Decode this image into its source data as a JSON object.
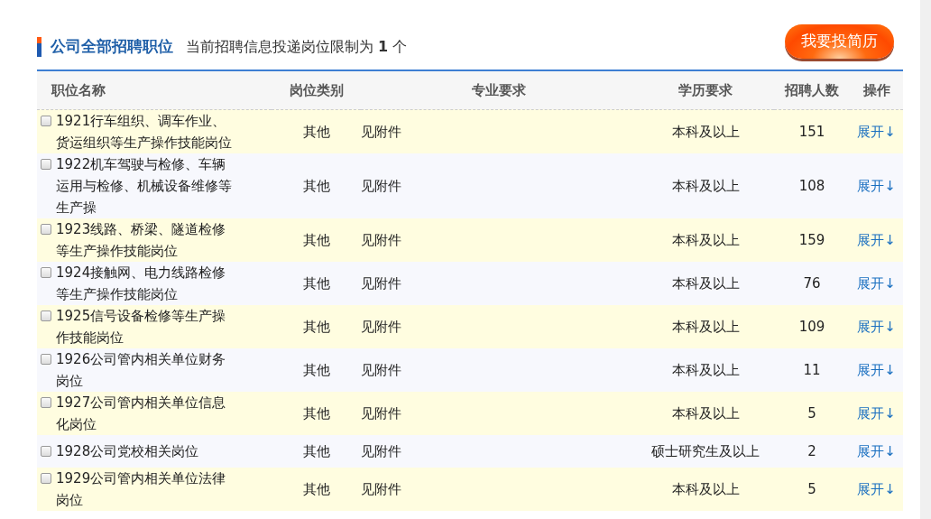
{
  "header": {
    "title": "公司全部招聘职位",
    "notice": "当前招聘信息投递岗位限制为 **1** 个",
    "apply_button": "我要投简历"
  },
  "table": {
    "columns": [
      "职位名称",
      "岗位类别",
      "专业要求",
      "学历要求",
      "招聘人数",
      "操作"
    ],
    "rows": [
      {
        "checked": false,
        "name_lines": [
          "1921行车组织、调车作业、",
          "货运组织等生产操作技能岗位"
        ],
        "category": "其他",
        "major": "见附件",
        "education": "本科及以上",
        "count": "151",
        "action": "展开↓"
      },
      {
        "checked": false,
        "name_lines": [
          "1922机车驾驶与检修、车辆",
          "运用与检修、机械设备维修等",
          "生产操"
        ],
        "category": "其他",
        "major": "见附件",
        "education": "本科及以上",
        "count": "108",
        "action": "展开↓"
      },
      {
        "checked": false,
        "name_lines": [
          "1923线路、桥梁、隧道检修",
          "等生产操作技能岗位"
        ],
        "category": "其他",
        "major": "见附件",
        "education": "本科及以上",
        "count": "159",
        "action": "展开↓"
      },
      {
        "checked": false,
        "name_lines": [
          "1924接触网、电力线路检修",
          "等生产操作技能岗位"
        ],
        "category": "其他",
        "major": "见附件",
        "education": "本科及以上",
        "count": "76",
        "action": "展开↓"
      },
      {
        "checked": false,
        "name_lines": [
          "1925信号设备检修等生产操",
          "作技能岗位"
        ],
        "category": "其他",
        "major": "见附件",
        "education": "本科及以上",
        "count": "109",
        "action": "展开↓"
      },
      {
        "checked": false,
        "name_lines": [
          "1926公司管内相关单位财务",
          "岗位"
        ],
        "category": "其他",
        "major": "见附件",
        "education": "本科及以上",
        "count": "11",
        "action": "展开↓"
      },
      {
        "checked": false,
        "name_lines": [
          "1927公司管内相关单位信息",
          "化岗位"
        ],
        "category": "其他",
        "major": "见附件",
        "education": "本科及以上",
        "count": "5",
        "action": "展开↓"
      },
      {
        "checked": false,
        "name_lines": [
          "1928公司党校相关岗位"
        ],
        "category": "其他",
        "major": "见附件",
        "education": "硕士研究生及以上",
        "count": "2",
        "action": "展开↓"
      },
      {
        "checked": false,
        "name_lines": [
          "1929公司管内相关单位法律",
          "岗位"
        ],
        "category": "其他",
        "major": "见附件",
        "education": "本科及以上",
        "count": "5",
        "action": "展开↓"
      }
    ]
  }
}
